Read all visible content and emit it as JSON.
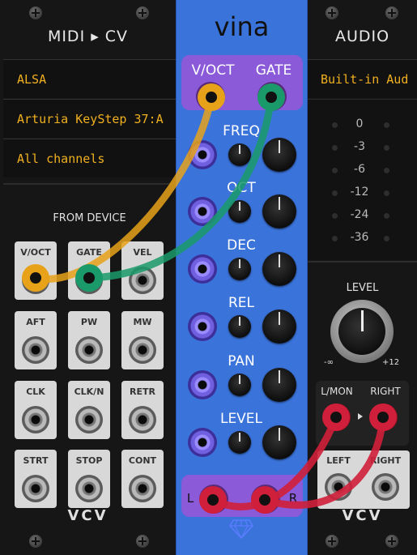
{
  "midi_cv": {
    "title": "MIDI ▸ CV",
    "driver": "ALSA",
    "device": "Arturia KeyStep 37:A",
    "channel": "All channels",
    "section_label": "FROM DEVICE",
    "jacks": [
      "V/OCT",
      "GATE",
      "VEL",
      "AFT",
      "PW",
      "MW",
      "CLK",
      "CLK/N",
      "RETR",
      "STRT",
      "STOP",
      "CONT"
    ],
    "logo": "VCV"
  },
  "vina": {
    "title": "vina",
    "top_inputs": [
      "V/OCT",
      "GATE"
    ],
    "params": [
      "FREQ",
      "OCT",
      "DEC",
      "REL",
      "PAN",
      "LEVEL"
    ],
    "out_left": "L",
    "out_right": "R"
  },
  "audio": {
    "title": "AUDIO",
    "device": "Built-in Aud",
    "meter_labels": [
      "0",
      "-3",
      "-6",
      "-12",
      "-24",
      "-36"
    ],
    "level_label": "LEVEL",
    "level_min": "-∞",
    "level_max": "+12",
    "input_labels": [
      "L/MON",
      "RIGHT"
    ],
    "output_labels": [
      "LEFT",
      "RIGHT"
    ],
    "logo": "VCV"
  },
  "cables": [
    {
      "color": "#e8a21a",
      "from": "midi_cv.V/OCT",
      "to": "vina.V/OCT"
    },
    {
      "color": "#1a9a6a",
      "from": "midi_cv.GATE",
      "to": "vina.GATE"
    },
    {
      "color": "#d01f3a",
      "from": "vina.L",
      "to": "audio.L/MON"
    },
    {
      "color": "#d01f3a",
      "from": "vina.R",
      "to": "audio.RIGHT"
    }
  ]
}
